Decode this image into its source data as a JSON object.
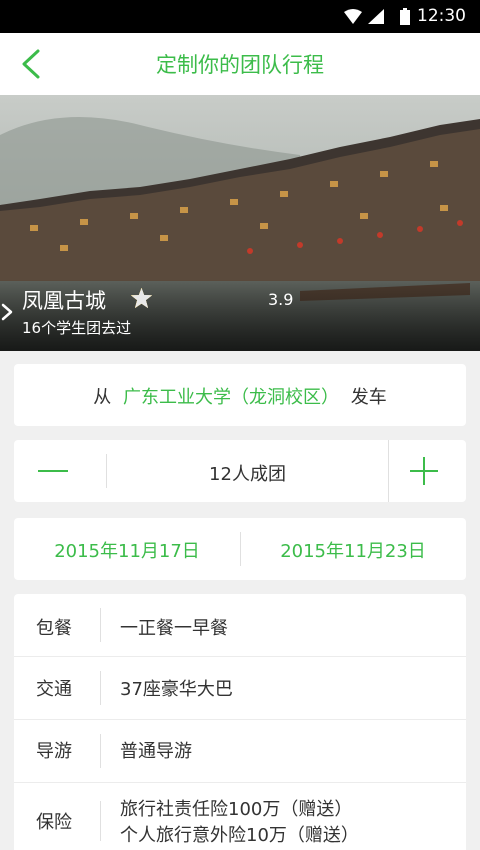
{
  "status_bar": {
    "time": "12:30"
  },
  "nav": {
    "title": "定制你的团队行程"
  },
  "hero": {
    "place": "凤凰古城",
    "rating": "3.9",
    "rating_value": 3.9,
    "visits": "16个学生团去过"
  },
  "departure": {
    "prefix": "从",
    "campus": "广东工业大学（龙洞校区）",
    "suffix": "发车"
  },
  "group": {
    "count_label": "12人成团"
  },
  "dates": {
    "start": "2015年11月17日",
    "end": "2015年11月23日"
  },
  "details": [
    {
      "label": "包餐",
      "value": "一正餐一早餐"
    },
    {
      "label": "交通",
      "value": "37座豪华大巴"
    },
    {
      "label": "导游",
      "value": "普通导游"
    },
    {
      "label": "保险",
      "value": "旅行社责任险100万（赠送）",
      "value2": "个人旅行意外险10万（赠送）"
    }
  ],
  "colors": {
    "accent": "#3cbc4a",
    "star": "#f2c12e",
    "background": "#f0f0f0"
  }
}
